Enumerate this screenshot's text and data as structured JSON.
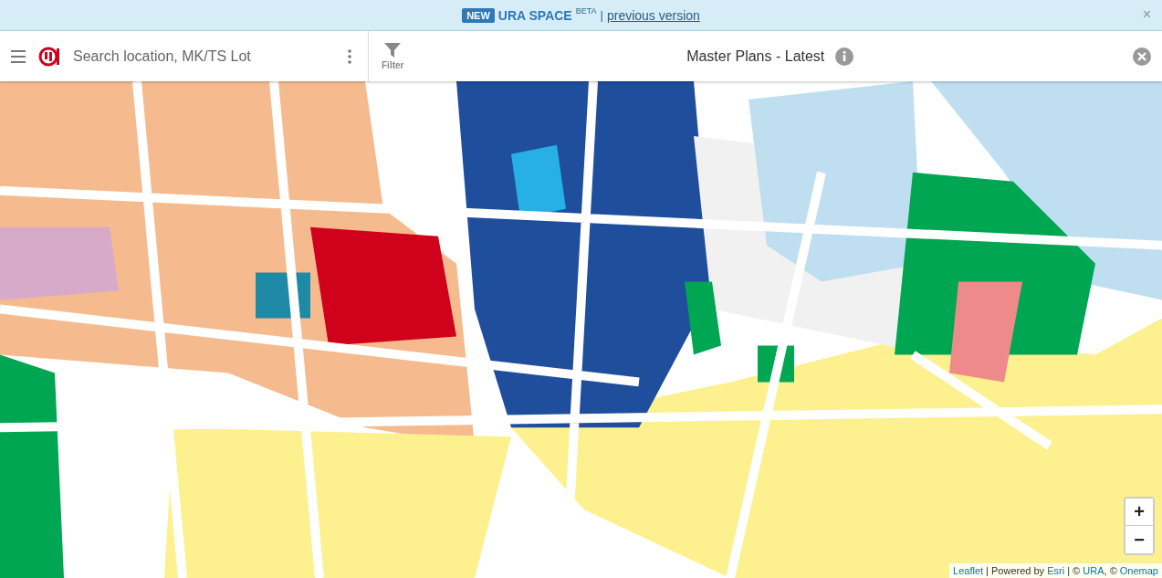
{
  "banner": {
    "badge": "NEW",
    "title": "URA SPACE",
    "superscript": "BETA",
    "separator": "|",
    "link": "previous version",
    "close": "×"
  },
  "toolbar": {
    "search": {
      "placeholder": "Search location, MK/TS Lot"
    },
    "filter_label": "Filter",
    "layer_title": "Master Plans - Latest"
  },
  "map": {
    "zoom_in": "+",
    "zoom_out": "−",
    "attribution": [
      {
        "kind": "link",
        "text": "Leaflet"
      },
      {
        "kind": "text",
        "text": " | Powered by "
      },
      {
        "kind": "link",
        "text": "Esri"
      },
      {
        "kind": "text",
        "text": " | © "
      },
      {
        "kind": "link",
        "text": "URA"
      },
      {
        "kind": "text",
        "text": ", © "
      },
      {
        "kind": "link",
        "text": "Onemap"
      }
    ]
  }
}
